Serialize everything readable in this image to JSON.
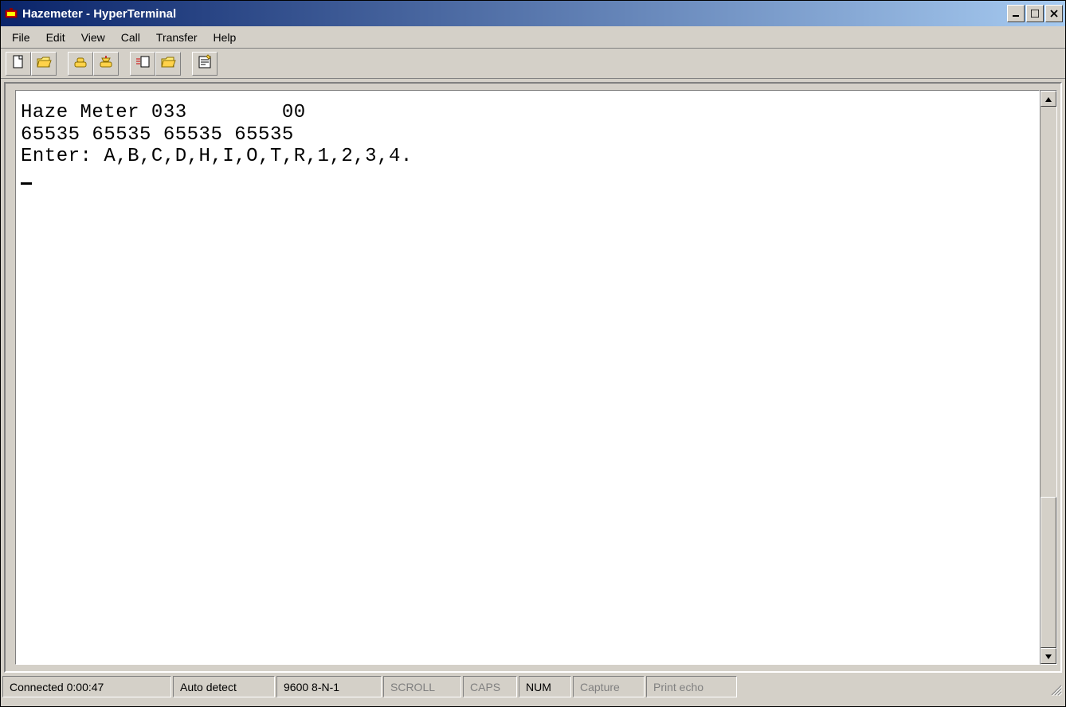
{
  "window": {
    "title": "Hazemeter - HyperTerminal"
  },
  "menu": {
    "items": [
      "File",
      "Edit",
      "View",
      "Call",
      "Transfer",
      "Help"
    ]
  },
  "toolbar": {
    "buttons": [
      {
        "name": "new-icon"
      },
      {
        "name": "open-icon"
      },
      {
        "name": "call-icon"
      },
      {
        "name": "hangup-icon"
      },
      {
        "name": "send-icon"
      },
      {
        "name": "receive-icon"
      },
      {
        "name": "properties-icon"
      }
    ]
  },
  "terminal": {
    "line1": "Haze Meter 033        00",
    "line2": "65535 65535 65535 65535",
    "line3": "Enter: A,B,C,D,H,I,O,T,R,1,2,3,4."
  },
  "status": {
    "connected": "Connected 0:00:47",
    "autodetect": "Auto detect",
    "port": "9600 8-N-1",
    "scroll": "SCROLL",
    "caps": "CAPS",
    "num": "NUM",
    "capture": "Capture",
    "printecho": "Print echo"
  }
}
